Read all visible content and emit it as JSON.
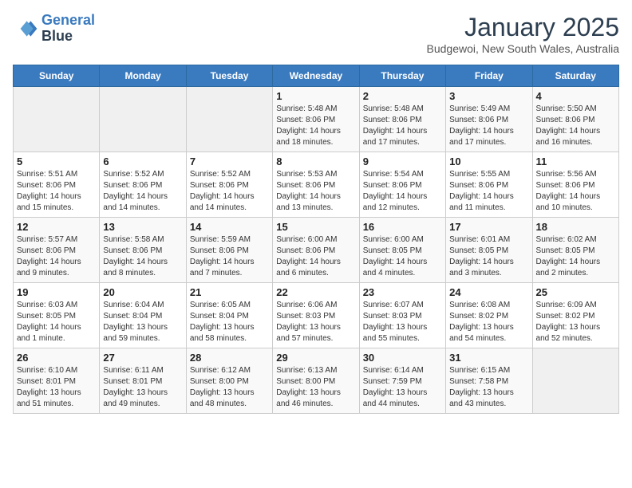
{
  "header": {
    "logo_line1": "General",
    "logo_line2": "Blue",
    "title": "January 2025",
    "subtitle": "Budgewoi, New South Wales, Australia"
  },
  "weekdays": [
    "Sunday",
    "Monday",
    "Tuesday",
    "Wednesday",
    "Thursday",
    "Friday",
    "Saturday"
  ],
  "weeks": [
    [
      {
        "day": "",
        "info": ""
      },
      {
        "day": "",
        "info": ""
      },
      {
        "day": "",
        "info": ""
      },
      {
        "day": "1",
        "info": "Sunrise: 5:48 AM\nSunset: 8:06 PM\nDaylight: 14 hours\nand 18 minutes."
      },
      {
        "day": "2",
        "info": "Sunrise: 5:48 AM\nSunset: 8:06 PM\nDaylight: 14 hours\nand 17 minutes."
      },
      {
        "day": "3",
        "info": "Sunrise: 5:49 AM\nSunset: 8:06 PM\nDaylight: 14 hours\nand 17 minutes."
      },
      {
        "day": "4",
        "info": "Sunrise: 5:50 AM\nSunset: 8:06 PM\nDaylight: 14 hours\nand 16 minutes."
      }
    ],
    [
      {
        "day": "5",
        "info": "Sunrise: 5:51 AM\nSunset: 8:06 PM\nDaylight: 14 hours\nand 15 minutes."
      },
      {
        "day": "6",
        "info": "Sunrise: 5:52 AM\nSunset: 8:06 PM\nDaylight: 14 hours\nand 14 minutes."
      },
      {
        "day": "7",
        "info": "Sunrise: 5:52 AM\nSunset: 8:06 PM\nDaylight: 14 hours\nand 14 minutes."
      },
      {
        "day": "8",
        "info": "Sunrise: 5:53 AM\nSunset: 8:06 PM\nDaylight: 14 hours\nand 13 minutes."
      },
      {
        "day": "9",
        "info": "Sunrise: 5:54 AM\nSunset: 8:06 PM\nDaylight: 14 hours\nand 12 minutes."
      },
      {
        "day": "10",
        "info": "Sunrise: 5:55 AM\nSunset: 8:06 PM\nDaylight: 14 hours\nand 11 minutes."
      },
      {
        "day": "11",
        "info": "Sunrise: 5:56 AM\nSunset: 8:06 PM\nDaylight: 14 hours\nand 10 minutes."
      }
    ],
    [
      {
        "day": "12",
        "info": "Sunrise: 5:57 AM\nSunset: 8:06 PM\nDaylight: 14 hours\nand 9 minutes."
      },
      {
        "day": "13",
        "info": "Sunrise: 5:58 AM\nSunset: 8:06 PM\nDaylight: 14 hours\nand 8 minutes."
      },
      {
        "day": "14",
        "info": "Sunrise: 5:59 AM\nSunset: 8:06 PM\nDaylight: 14 hours\nand 7 minutes."
      },
      {
        "day": "15",
        "info": "Sunrise: 6:00 AM\nSunset: 8:06 PM\nDaylight: 14 hours\nand 6 minutes."
      },
      {
        "day": "16",
        "info": "Sunrise: 6:00 AM\nSunset: 8:05 PM\nDaylight: 14 hours\nand 4 minutes."
      },
      {
        "day": "17",
        "info": "Sunrise: 6:01 AM\nSunset: 8:05 PM\nDaylight: 14 hours\nand 3 minutes."
      },
      {
        "day": "18",
        "info": "Sunrise: 6:02 AM\nSunset: 8:05 PM\nDaylight: 14 hours\nand 2 minutes."
      }
    ],
    [
      {
        "day": "19",
        "info": "Sunrise: 6:03 AM\nSunset: 8:05 PM\nDaylight: 14 hours\nand 1 minute."
      },
      {
        "day": "20",
        "info": "Sunrise: 6:04 AM\nSunset: 8:04 PM\nDaylight: 13 hours\nand 59 minutes."
      },
      {
        "day": "21",
        "info": "Sunrise: 6:05 AM\nSunset: 8:04 PM\nDaylight: 13 hours\nand 58 minutes."
      },
      {
        "day": "22",
        "info": "Sunrise: 6:06 AM\nSunset: 8:03 PM\nDaylight: 13 hours\nand 57 minutes."
      },
      {
        "day": "23",
        "info": "Sunrise: 6:07 AM\nSunset: 8:03 PM\nDaylight: 13 hours\nand 55 minutes."
      },
      {
        "day": "24",
        "info": "Sunrise: 6:08 AM\nSunset: 8:02 PM\nDaylight: 13 hours\nand 54 minutes."
      },
      {
        "day": "25",
        "info": "Sunrise: 6:09 AM\nSunset: 8:02 PM\nDaylight: 13 hours\nand 52 minutes."
      }
    ],
    [
      {
        "day": "26",
        "info": "Sunrise: 6:10 AM\nSunset: 8:01 PM\nDaylight: 13 hours\nand 51 minutes."
      },
      {
        "day": "27",
        "info": "Sunrise: 6:11 AM\nSunset: 8:01 PM\nDaylight: 13 hours\nand 49 minutes."
      },
      {
        "day": "28",
        "info": "Sunrise: 6:12 AM\nSunset: 8:00 PM\nDaylight: 13 hours\nand 48 minutes."
      },
      {
        "day": "29",
        "info": "Sunrise: 6:13 AM\nSunset: 8:00 PM\nDaylight: 13 hours\nand 46 minutes."
      },
      {
        "day": "30",
        "info": "Sunrise: 6:14 AM\nSunset: 7:59 PM\nDaylight: 13 hours\nand 44 minutes."
      },
      {
        "day": "31",
        "info": "Sunrise: 6:15 AM\nSunset: 7:58 PM\nDaylight: 13 hours\nand 43 minutes."
      },
      {
        "day": "",
        "info": ""
      }
    ]
  ]
}
